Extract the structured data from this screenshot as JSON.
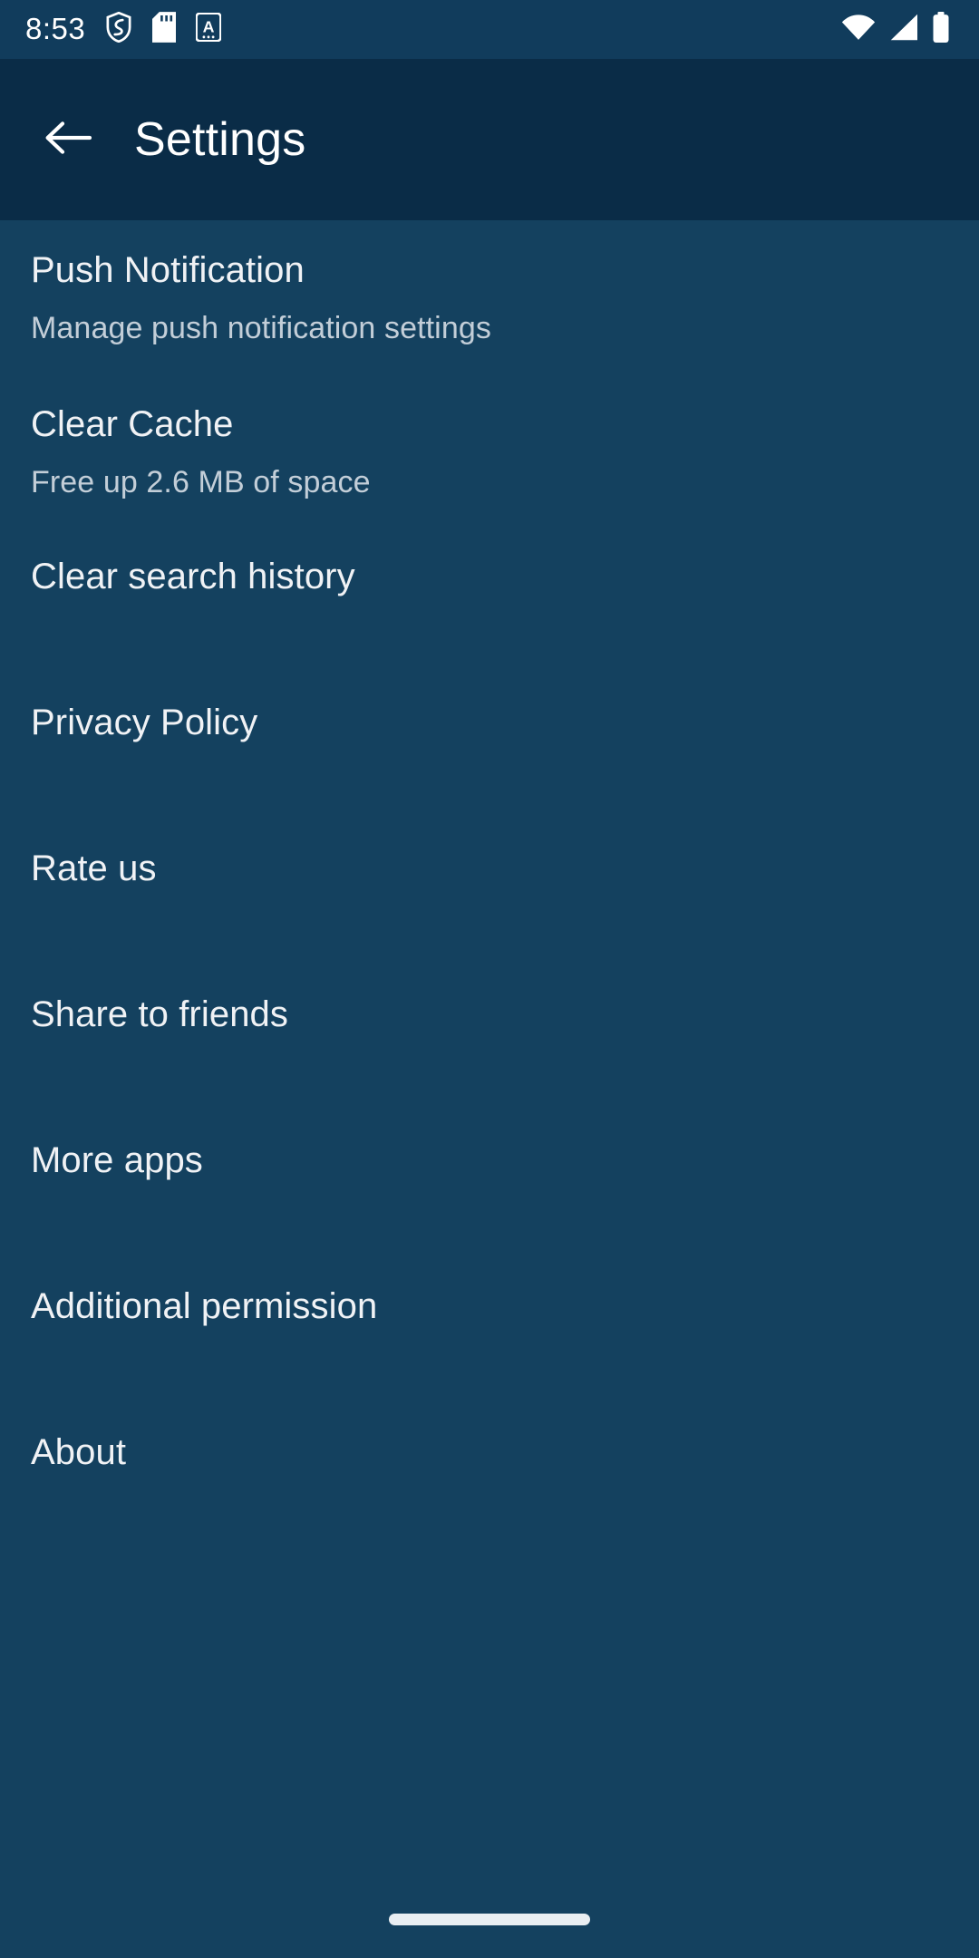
{
  "status_bar": {
    "clock": "8:53",
    "left_icons": [
      {
        "name": "vpn-shield-icon"
      },
      {
        "name": "sd-card-icon"
      },
      {
        "name": "alphabet-keyboard-icon",
        "glyph": "A"
      }
    ],
    "right_icons": [
      {
        "name": "wifi-icon"
      },
      {
        "name": "cellular-signal-icon"
      },
      {
        "name": "battery-icon"
      }
    ]
  },
  "app_bar": {
    "back_label": "Back",
    "title": "Settings"
  },
  "settings": {
    "items": [
      {
        "title": "Push Notification",
        "subtitle": "Manage push notification settings"
      },
      {
        "title": "Clear Cache",
        "subtitle": "Free up 2.6 MB of space"
      },
      {
        "title": "Clear search history",
        "subtitle": ""
      },
      {
        "title": "Privacy Policy",
        "subtitle": ""
      },
      {
        "title": "Rate us",
        "subtitle": ""
      },
      {
        "title": "Share to friends",
        "subtitle": ""
      },
      {
        "title": "More apps",
        "subtitle": ""
      },
      {
        "title": "Additional permission",
        "subtitle": ""
      },
      {
        "title": "About",
        "subtitle": ""
      }
    ]
  },
  "nav_bar": {
    "home_indicator": "home-gesture-pill"
  },
  "colors": {
    "status_bar_bg": "#113c5c",
    "app_bar_bg": "#0a2c47",
    "content_bg": "#14415f",
    "title_text": "#f0f2f5",
    "subtitle_text": "#c3ced8",
    "pill": "#e9eef2"
  }
}
